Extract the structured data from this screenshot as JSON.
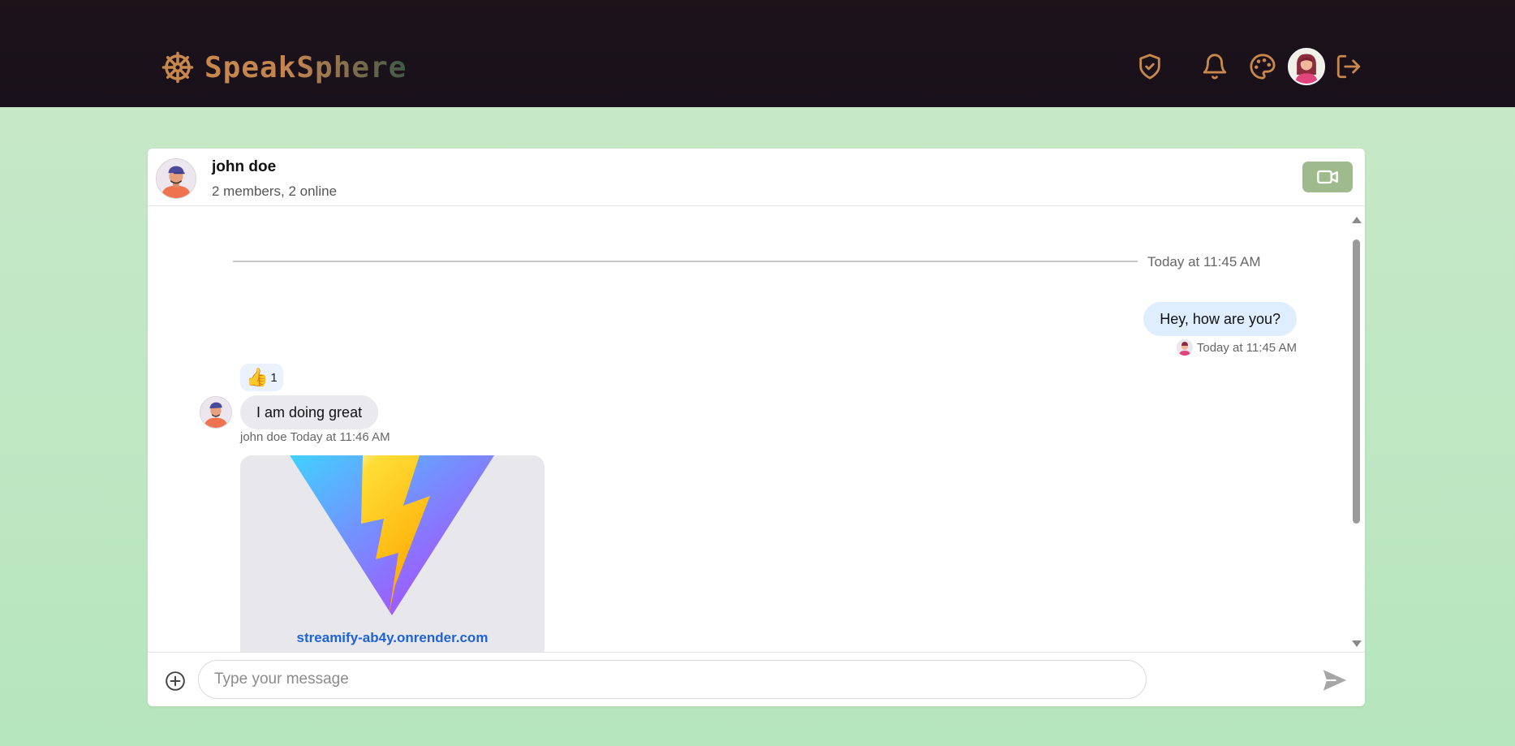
{
  "app": {
    "name": "SpeakSphere",
    "icons": [
      "ship-wheel-icon",
      "shield-check-icon",
      "bell-icon",
      "palette-icon",
      "logout-icon"
    ],
    "colors": {
      "brand_gradient_start": "#c9884c",
      "brand_gradient_end": "#3f5947",
      "navbar_bg": "#1a1118",
      "nav_icon": "#c8884c",
      "page_bg": "#b6e6bd"
    }
  },
  "chat": {
    "title": "john doe",
    "subtitle": "2 members, 2 online",
    "video_button_color": "#9fba8c"
  },
  "messages": {
    "date_divider": "Today at 11:45 AM",
    "items": [
      {
        "sender": "me",
        "text": "Hey, how are you?",
        "meta": "Today at 11:45 AM",
        "bubble_color": "#dfeeff"
      },
      {
        "sender": "john doe",
        "reaction": {
          "emoji": "👍",
          "count": "1"
        },
        "text": "I am doing great",
        "meta": "john doe Today at 11:46 AM",
        "bubble_color": "#e9e9ee"
      },
      {
        "sender": "john doe",
        "link_preview": {
          "url": "streamify-ab4y.onrender.com",
          "image": "vite-logo"
        }
      }
    ]
  },
  "composer": {
    "placeholder": "Type your message",
    "value": ""
  }
}
